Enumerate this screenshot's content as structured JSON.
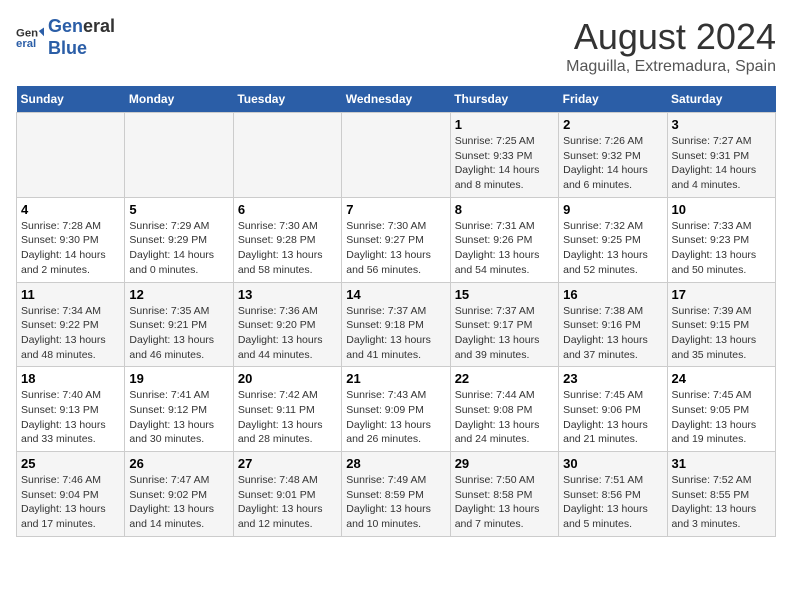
{
  "logo": {
    "line1": "General",
    "line2": "Blue"
  },
  "title": "August 2024",
  "subtitle": "Maguilla, Extremadura, Spain",
  "days_of_week": [
    "Sunday",
    "Monday",
    "Tuesday",
    "Wednesday",
    "Thursday",
    "Friday",
    "Saturday"
  ],
  "weeks": [
    [
      {
        "day": "",
        "info": ""
      },
      {
        "day": "",
        "info": ""
      },
      {
        "day": "",
        "info": ""
      },
      {
        "day": "",
        "info": ""
      },
      {
        "day": "1",
        "info": "Sunrise: 7:25 AM\nSunset: 9:33 PM\nDaylight: 14 hours and 8 minutes."
      },
      {
        "day": "2",
        "info": "Sunrise: 7:26 AM\nSunset: 9:32 PM\nDaylight: 14 hours and 6 minutes."
      },
      {
        "day": "3",
        "info": "Sunrise: 7:27 AM\nSunset: 9:31 PM\nDaylight: 14 hours and 4 minutes."
      }
    ],
    [
      {
        "day": "4",
        "info": "Sunrise: 7:28 AM\nSunset: 9:30 PM\nDaylight: 14 hours and 2 minutes."
      },
      {
        "day": "5",
        "info": "Sunrise: 7:29 AM\nSunset: 9:29 PM\nDaylight: 14 hours and 0 minutes."
      },
      {
        "day": "6",
        "info": "Sunrise: 7:30 AM\nSunset: 9:28 PM\nDaylight: 13 hours and 58 minutes."
      },
      {
        "day": "7",
        "info": "Sunrise: 7:30 AM\nSunset: 9:27 PM\nDaylight: 13 hours and 56 minutes."
      },
      {
        "day": "8",
        "info": "Sunrise: 7:31 AM\nSunset: 9:26 PM\nDaylight: 13 hours and 54 minutes."
      },
      {
        "day": "9",
        "info": "Sunrise: 7:32 AM\nSunset: 9:25 PM\nDaylight: 13 hours and 52 minutes."
      },
      {
        "day": "10",
        "info": "Sunrise: 7:33 AM\nSunset: 9:23 PM\nDaylight: 13 hours and 50 minutes."
      }
    ],
    [
      {
        "day": "11",
        "info": "Sunrise: 7:34 AM\nSunset: 9:22 PM\nDaylight: 13 hours and 48 minutes."
      },
      {
        "day": "12",
        "info": "Sunrise: 7:35 AM\nSunset: 9:21 PM\nDaylight: 13 hours and 46 minutes."
      },
      {
        "day": "13",
        "info": "Sunrise: 7:36 AM\nSunset: 9:20 PM\nDaylight: 13 hours and 44 minutes."
      },
      {
        "day": "14",
        "info": "Sunrise: 7:37 AM\nSunset: 9:18 PM\nDaylight: 13 hours and 41 minutes."
      },
      {
        "day": "15",
        "info": "Sunrise: 7:37 AM\nSunset: 9:17 PM\nDaylight: 13 hours and 39 minutes."
      },
      {
        "day": "16",
        "info": "Sunrise: 7:38 AM\nSunset: 9:16 PM\nDaylight: 13 hours and 37 minutes."
      },
      {
        "day": "17",
        "info": "Sunrise: 7:39 AM\nSunset: 9:15 PM\nDaylight: 13 hours and 35 minutes."
      }
    ],
    [
      {
        "day": "18",
        "info": "Sunrise: 7:40 AM\nSunset: 9:13 PM\nDaylight: 13 hours and 33 minutes."
      },
      {
        "day": "19",
        "info": "Sunrise: 7:41 AM\nSunset: 9:12 PM\nDaylight: 13 hours and 30 minutes."
      },
      {
        "day": "20",
        "info": "Sunrise: 7:42 AM\nSunset: 9:11 PM\nDaylight: 13 hours and 28 minutes."
      },
      {
        "day": "21",
        "info": "Sunrise: 7:43 AM\nSunset: 9:09 PM\nDaylight: 13 hours and 26 minutes."
      },
      {
        "day": "22",
        "info": "Sunrise: 7:44 AM\nSunset: 9:08 PM\nDaylight: 13 hours and 24 minutes."
      },
      {
        "day": "23",
        "info": "Sunrise: 7:45 AM\nSunset: 9:06 PM\nDaylight: 13 hours and 21 minutes."
      },
      {
        "day": "24",
        "info": "Sunrise: 7:45 AM\nSunset: 9:05 PM\nDaylight: 13 hours and 19 minutes."
      }
    ],
    [
      {
        "day": "25",
        "info": "Sunrise: 7:46 AM\nSunset: 9:04 PM\nDaylight: 13 hours and 17 minutes."
      },
      {
        "day": "26",
        "info": "Sunrise: 7:47 AM\nSunset: 9:02 PM\nDaylight: 13 hours and 14 minutes."
      },
      {
        "day": "27",
        "info": "Sunrise: 7:48 AM\nSunset: 9:01 PM\nDaylight: 13 hours and 12 minutes."
      },
      {
        "day": "28",
        "info": "Sunrise: 7:49 AM\nSunset: 8:59 PM\nDaylight: 13 hours and 10 minutes."
      },
      {
        "day": "29",
        "info": "Sunrise: 7:50 AM\nSunset: 8:58 PM\nDaylight: 13 hours and 7 minutes."
      },
      {
        "day": "30",
        "info": "Sunrise: 7:51 AM\nSunset: 8:56 PM\nDaylight: 13 hours and 5 minutes."
      },
      {
        "day": "31",
        "info": "Sunrise: 7:52 AM\nSunset: 8:55 PM\nDaylight: 13 hours and 3 minutes."
      }
    ]
  ]
}
